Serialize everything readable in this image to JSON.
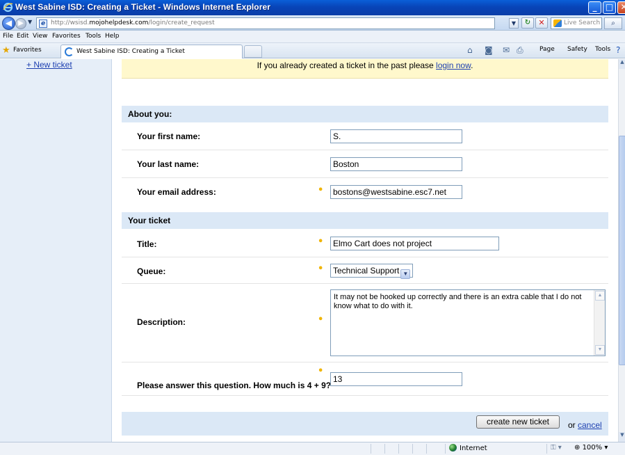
{
  "window": {
    "title": "West Sabine ISD: Creating a Ticket - Windows Internet Explorer",
    "controls": {
      "minimize": "_",
      "maximize": "□",
      "close": "✕"
    }
  },
  "address_bar": {
    "url_prefix": "http://wsisd.",
    "url_domain": "mojohelpdesk.com",
    "url_path": "/login/create_request",
    "search_placeholder": "Live Search"
  },
  "menu": {
    "items": [
      "File",
      "Edit",
      "View",
      "Favorites",
      "Tools",
      "Help"
    ]
  },
  "favorites_bar": {
    "favorites_label": "Favorites",
    "tab_label": "West Sabine ISD: Creating a Ticket",
    "commands": {
      "page": "Page",
      "safety": "Safety",
      "tools": "Tools"
    }
  },
  "sidebar": {
    "new_ticket_link": "+ New ticket"
  },
  "notice": {
    "text": "If you already created a ticket in the past please ",
    "link": "login now",
    "suffix": "."
  },
  "form": {
    "about_heading": "About you:",
    "first_name_label": "Your first name:",
    "first_name_value": "S.",
    "last_name_label": "Your last name:",
    "last_name_value": "Boston",
    "email_label": "Your email address:",
    "email_value": "bostons@westsabine.esc7.net",
    "ticket_heading": "Your ticket",
    "title_label": "Title:",
    "title_value": "Elmo Cart does not project",
    "queue_label": "Queue:",
    "queue_value": "Technical Support",
    "description_label": "Description:",
    "description_value": "It may not be hooked up correctly and there is an extra cable that I do not know what to do with it.",
    "captcha_label": "Please answer this question. How much is 4 + 9?",
    "captcha_value": "13",
    "required_marker": "•",
    "submit_label": "create new ticket",
    "or_text": "or",
    "cancel_label": "cancel"
  },
  "status_bar": {
    "zone": "Internet",
    "zoom": "100%"
  },
  "colors": {
    "section_bg": "#dbe8f6",
    "notice_bg": "#fff8cc",
    "link": "#1c3fb0",
    "required": "#f0b400"
  }
}
